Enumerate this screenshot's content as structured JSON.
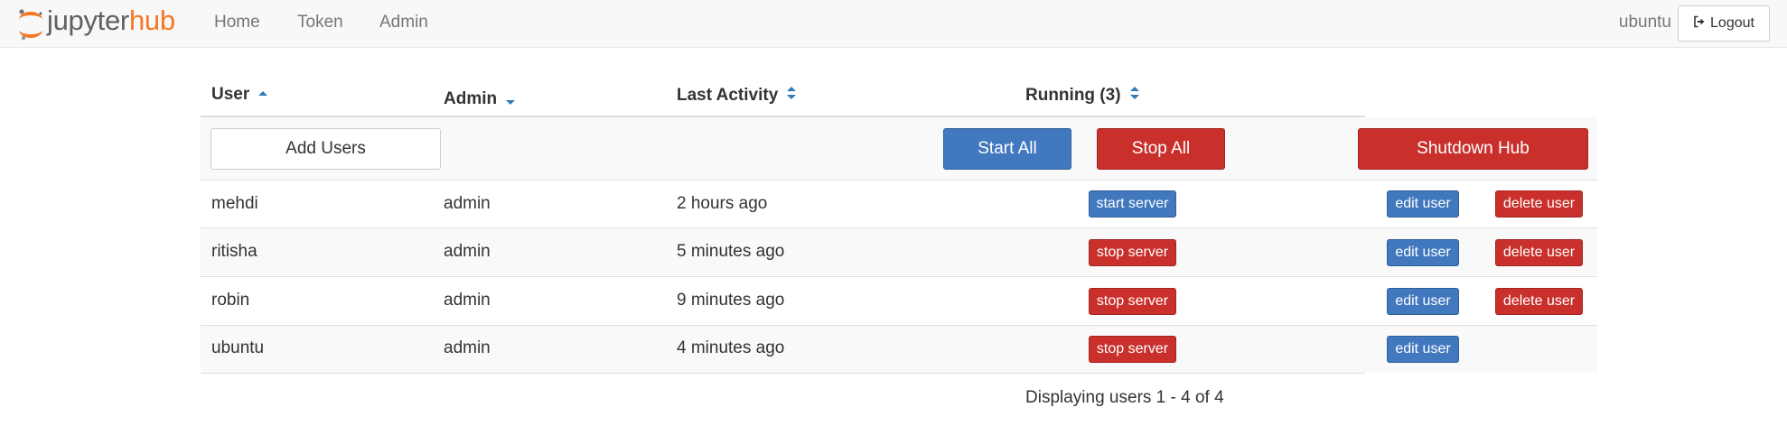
{
  "nav": {
    "brand_prefix": "jupyter",
    "brand_suffix": "hub",
    "links": [
      "Home",
      "Token",
      "Admin"
    ],
    "username": "ubuntu",
    "logout_label": "Logout"
  },
  "table": {
    "headers": {
      "user": "User",
      "admin": "Admin",
      "last_activity": "Last Activity",
      "running": "Running (3)"
    },
    "actions": {
      "add_users": "Add Users",
      "start_all": "Start All",
      "stop_all": "Stop All",
      "shutdown_hub": "Shutdown Hub"
    },
    "rows": [
      {
        "name": "mehdi",
        "admin": "admin",
        "last_activity": "2 hours ago",
        "server_action": "start server",
        "edit": "edit user",
        "delete": "delete user"
      },
      {
        "name": "ritisha",
        "admin": "admin",
        "last_activity": "5 minutes ago",
        "server_action": "stop server",
        "edit": "edit user",
        "delete": "delete user"
      },
      {
        "name": "robin",
        "admin": "admin",
        "last_activity": "9 minutes ago",
        "server_action": "stop server",
        "edit": "edit user",
        "delete": "delete user"
      },
      {
        "name": "ubuntu",
        "admin": "admin",
        "last_activity": "4 minutes ago",
        "server_action": "stop server",
        "edit": "edit user"
      }
    ],
    "footer": "Displaying users 1 - 4 of 4"
  },
  "colors": {
    "primary": "#4178be",
    "danger": "#c9302c",
    "brand_orange": "#f37726",
    "brand_gray": "#616161"
  },
  "icons": [
    "sort-asc-icon",
    "sort-desc-icon",
    "sort-both-icon",
    "sign-out-icon"
  ]
}
